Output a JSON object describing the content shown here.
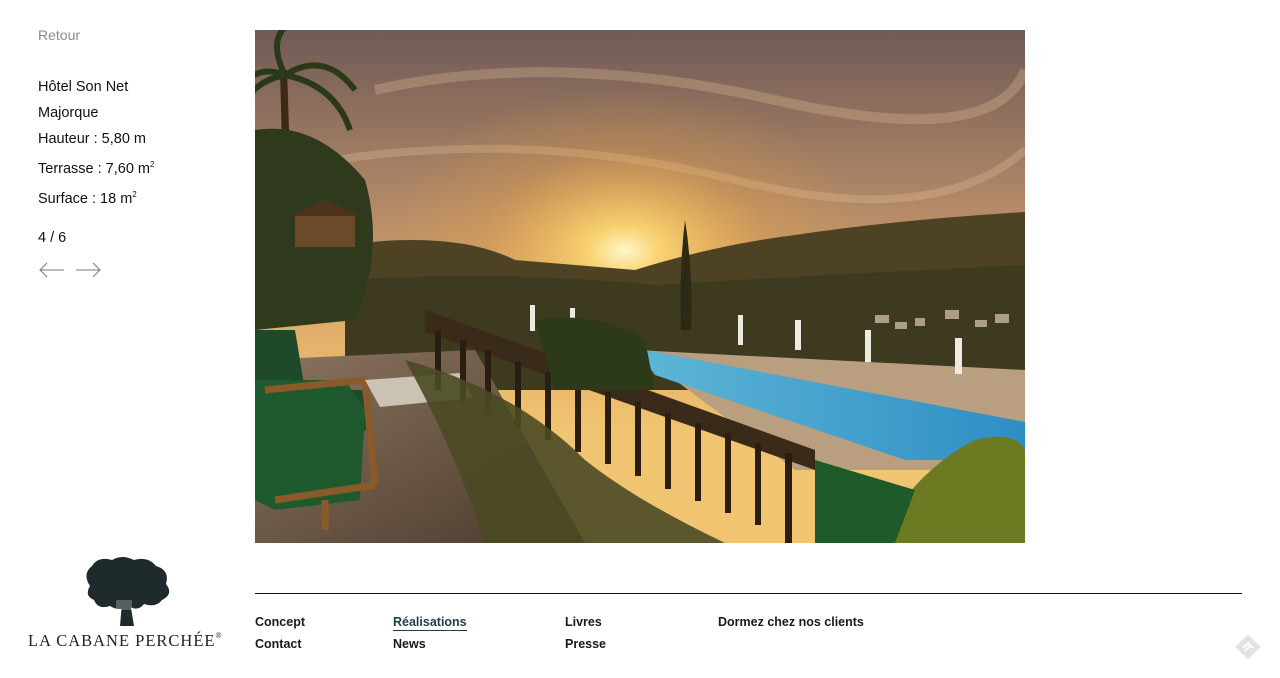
{
  "back": {
    "label": "Retour"
  },
  "project": {
    "name": "Hôtel Son Net",
    "location": "Majorque",
    "height": "Hauteur : 5,80 m",
    "terrace": "Terrasse : 7,60 m",
    "surface": "Surface : 18 m",
    "area_sup": "2"
  },
  "gallery": {
    "counter": "4 / 6",
    "current": 4,
    "total": 6
  },
  "nav": {
    "concept": "Concept",
    "contact": "Contact",
    "realisations": "Réalisations",
    "news": "News",
    "livres": "Livres",
    "presse": "Presse",
    "dormez": "Dormez chez nos clients"
  },
  "brand": {
    "name": "LA CABANE PERCHÉE",
    "mark": "®"
  },
  "colors": {
    "active_link": "#1b3f48",
    "muted": "#8a8a8a",
    "text": "#111111"
  },
  "icons": {
    "prev": "arrow-left-icon",
    "next": "arrow-right-icon",
    "logo": "tree-logo-icon",
    "corner": "diamond-badge-icon"
  }
}
